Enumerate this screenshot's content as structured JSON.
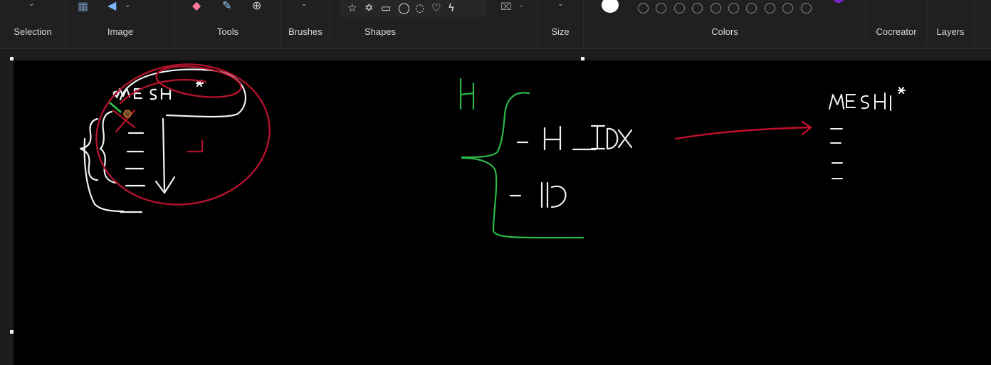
{
  "ribbon": {
    "groups": {
      "selection": "Selection",
      "image": "Image",
      "tools": "Tools",
      "brushes": "Brushes",
      "shapes": "Shapes",
      "size": "Size",
      "colors": "Colors",
      "cocreator": "Cocreator",
      "layers": "Layers"
    },
    "icons": {
      "selection_dropdown": "chevron-down-icon",
      "image_crop": "crop-icon",
      "image_rotate": "rotate-icon",
      "eraser": "eraser-icon",
      "color_picker": "eyedropper-icon",
      "magnifier": "magnifier-icon",
      "brushes_dropdown": "chevron-down-icon",
      "shape_fill": "shape-fill-icon",
      "size_dropdown": "chevron-down-icon"
    },
    "shapes_list": [
      "star-5",
      "star-6",
      "callout-rect",
      "callout-round",
      "callout-cloud",
      "heart",
      "lightning"
    ],
    "colors": {
      "primary": "#ffffff",
      "secondary_partial": "#7a22c9",
      "palette_empty_slots": 10
    }
  },
  "canvas": {
    "background": "#000000",
    "drawing": {
      "left_sketch": {
        "label": "MESH*",
        "color_outline": "#b0102a",
        "color_text": "#ffffff"
      },
      "middle_sketch": {
        "label_h": "H",
        "item_hidx": "- H_IDX",
        "item_id": "- ID",
        "brace_color": "#2db84a"
      },
      "right_sketch": {
        "label": "MESH*",
        "arrow_color": "#c0102a"
      }
    }
  }
}
